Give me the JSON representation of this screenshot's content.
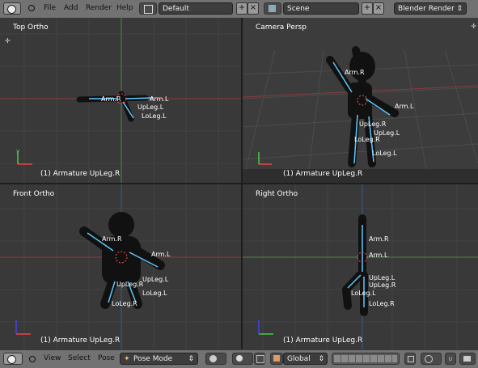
{
  "menu": {
    "file": "File",
    "add": "Add",
    "render": "Render",
    "help": "Help"
  },
  "screen_layout": "Default",
  "scene": "Scene",
  "render_engine": "Blender Render",
  "viewports": {
    "top": {
      "label": "Top Ortho",
      "footer": "(1) Armature UpLeg.R"
    },
    "camera": {
      "label": "Camera Persp",
      "footer": "(1) Armature UpLeg.R"
    },
    "front": {
      "label": "Front Ortho",
      "footer": "(1) Armature UpLeg.R"
    },
    "right": {
      "label": "Right Ortho",
      "footer": "(1) Armature UpLeg.R"
    }
  },
  "bones": {
    "arm_r": "Arm.R",
    "arm_l": "Arm.L",
    "upleg_l": "UpLeg.L",
    "upleg_r": "UpLeg.R",
    "loleg_l": "LoLeg.L",
    "loleg_r": "LoLeg.R"
  },
  "axis": {
    "x": "x",
    "y": "y",
    "z": "z"
  },
  "footer_bar": {
    "view": "View",
    "select": "Select",
    "pose": "Pose",
    "mode": "Pose Mode",
    "orientation": "Global"
  },
  "colors": {
    "header": "#727272",
    "viewport": "#393939",
    "selected": "#f0a040",
    "bone": "#5fc8ff"
  }
}
